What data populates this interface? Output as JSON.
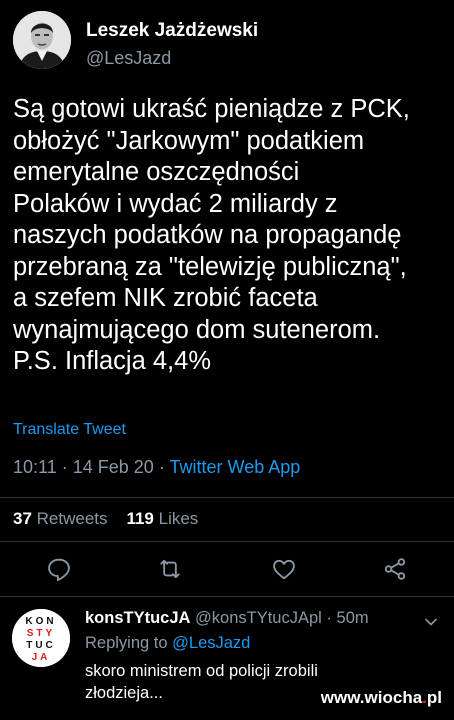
{
  "author": {
    "name": "Leszek Jażdżewski",
    "handle": "@LesJazd"
  },
  "tweet": {
    "lines": [
      "Są gotowi ukraść pieniądze z PCK,",
      "obłożyć \"Jarkowym\" podatkiem",
      "emerytalne oszczędności",
      "Polaków i wydać 2 miliardy z",
      "naszych podatków na propagandę",
      "przebraną za \"telewizję publiczną\",",
      "a szefem NIK zrobić faceta",
      "wynajmującego dom sutenerom.",
      "P.S. Inflacja 4,4%"
    ],
    "translate_label": "Translate Tweet",
    "time": "10:11",
    "date": "14 Feb 20",
    "separator": "·",
    "source": "Twitter Web App"
  },
  "stats": {
    "retweets_count": "37",
    "retweets_label": "Retweets",
    "likes_count": "119",
    "likes_label": "Likes"
  },
  "actions": {
    "icons": [
      "reply-icon",
      "retweet-icon",
      "like-icon",
      "share-icon"
    ]
  },
  "reply": {
    "name": "konsTYtucJA",
    "handle": "@konsTYtucJApl",
    "separator": "·",
    "age": "50m",
    "replying_prefix": "Replying to",
    "replying_mention": "@LesJazd",
    "lines": [
      "skoro ministrem od policji zrobili",
      "złodzieja..."
    ],
    "avatar_letters": {
      "row1": "KON",
      "row2": "STY",
      "row3": "TUC",
      "row4": "JA"
    }
  },
  "watermark": {
    "prefix": "www.",
    "brand": "wiocha",
    "dot": ".",
    "tld": "pl"
  },
  "colors": {
    "background": "#000000",
    "link": "#1d9bf0",
    "muted": "#8b98a5",
    "divider": "#2f3336",
    "watermark_accent": "#e0231d"
  }
}
